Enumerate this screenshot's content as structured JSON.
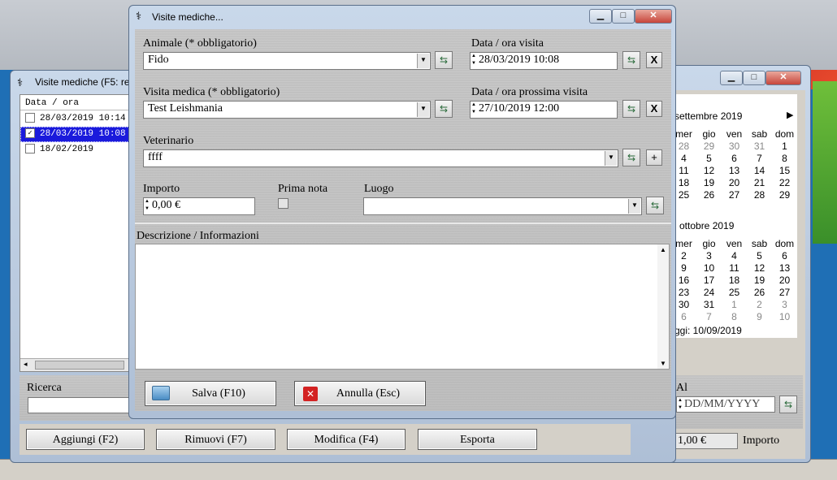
{
  "left_window": {
    "title": "Visite mediche (F5: re",
    "list_header": "Data / ora",
    "list_items": [
      {
        "label": "28/03/2019 10:14",
        "checked": false,
        "selected": false
      },
      {
        "label": "28/03/2019 10:08",
        "checked": true,
        "selected": true
      },
      {
        "label": "18/02/2019",
        "checked": false,
        "selected": false
      }
    ],
    "search_label": "Ricerca",
    "buttons": {
      "add": "Aggiungi (F2)",
      "remove": "Rimuovi (F7)",
      "edit": "Modifica (F4)",
      "export": "Esporta"
    }
  },
  "right_window": {
    "cal1": {
      "month": "settembre 2019",
      "days_header": [
        "mer",
        "gio",
        "ven",
        "sab",
        "dom"
      ],
      "rows": [
        [
          {
            "d": "28",
            "g": true
          },
          {
            "d": "29",
            "g": true
          },
          {
            "d": "30",
            "g": true
          },
          {
            "d": "31",
            "g": true
          },
          {
            "d": "1",
            "g": false
          }
        ],
        [
          {
            "d": "4"
          },
          {
            "d": "5"
          },
          {
            "d": "6"
          },
          {
            "d": "7"
          },
          {
            "d": "8"
          }
        ],
        [
          {
            "d": "11"
          },
          {
            "d": "12"
          },
          {
            "d": "13"
          },
          {
            "d": "14"
          },
          {
            "d": "15"
          }
        ],
        [
          {
            "d": "18"
          },
          {
            "d": "19"
          },
          {
            "d": "20"
          },
          {
            "d": "21"
          },
          {
            "d": "22"
          }
        ],
        [
          {
            "d": "25"
          },
          {
            "d": "26"
          },
          {
            "d": "27"
          },
          {
            "d": "28"
          },
          {
            "d": "29"
          }
        ]
      ]
    },
    "cal2": {
      "month": "ottobre 2019",
      "days_header": [
        "mer",
        "gio",
        "ven",
        "sab",
        "dom"
      ],
      "rows": [
        [
          {
            "d": "2"
          },
          {
            "d": "3"
          },
          {
            "d": "4"
          },
          {
            "d": "5"
          },
          {
            "d": "6"
          }
        ],
        [
          {
            "d": "9"
          },
          {
            "d": "10"
          },
          {
            "d": "11"
          },
          {
            "d": "12"
          },
          {
            "d": "13"
          }
        ],
        [
          {
            "d": "16"
          },
          {
            "d": "17"
          },
          {
            "d": "18"
          },
          {
            "d": "19"
          },
          {
            "d": "20"
          }
        ],
        [
          {
            "d": "23"
          },
          {
            "d": "24"
          },
          {
            "d": "25"
          },
          {
            "d": "26"
          },
          {
            "d": "27"
          }
        ],
        [
          {
            "d": "30"
          },
          {
            "d": "31"
          },
          {
            "d": "1",
            "g": true
          },
          {
            "d": "2",
            "g": true
          },
          {
            "d": "3",
            "g": true
          }
        ],
        [
          {
            "d": "6",
            "g": true
          },
          {
            "d": "7",
            "g": true
          },
          {
            "d": "8",
            "g": true
          },
          {
            "d": "9",
            "g": true
          },
          {
            "d": "10",
            "g": true
          }
        ]
      ]
    },
    "today": "ggi: 10/09/2019",
    "al_label": "Al",
    "date_placeholder": "DD/MM/YYYY",
    "total_value": "1,00 €",
    "total_label": "Importo"
  },
  "dialog": {
    "title": "Visite mediche...",
    "animale_label": "Animale (* obbligatorio)",
    "animale_value": "Fido",
    "data_visita_label": "Data / ora visita",
    "data_visita_value": "28/03/2019 10:08",
    "visita_label": "Visita medica (* obbligatorio)",
    "visita_value": "Test Leishmania",
    "prossima_label": "Data / ora prossima visita",
    "prossima_value": "27/10/2019 12:00",
    "veterinario_label": "Veterinario",
    "veterinario_value": "ffff",
    "importo_label": "Importo",
    "importo_value": "0,00 €",
    "prima_nota_label": "Prima nota",
    "luogo_label": "Luogo",
    "luogo_value": "",
    "descrizione_label": "Descrizione / Informazioni",
    "descrizione_value": "",
    "save_label": "Salva (F10)",
    "cancel_label": "Annulla (Esc)",
    "clear_symbol": "X",
    "add_symbol": "+"
  }
}
